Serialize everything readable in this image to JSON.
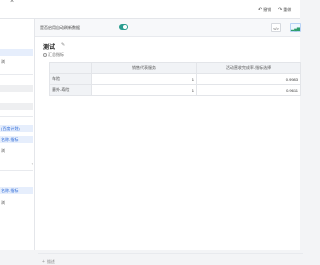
{
  "topbar": {
    "close_icon": "×",
    "btn1_label": "撤销",
    "btn2_label": "重做",
    "btn1_icon": "undo-icon",
    "btn2_icon": "redo-icon"
  },
  "left_panel": {
    "rows": [
      {
        "label": "",
        "style": ""
      },
      {
        "label": "",
        "style": "sel"
      },
      {
        "label": "浏",
        "style": ""
      },
      {
        "label": "",
        "style": "gray"
      },
      {
        "label": "",
        "style": "gray"
      },
      {
        "label": "",
        "style": ""
      },
      {
        "label": "(百度计划)",
        "style": "sel"
      },
      {
        "label": "名称-指标",
        "style": "sel"
      },
      {
        "label": "浏",
        "style": ""
      },
      {
        "label": "",
        "style": ""
      },
      {
        "label": "名称-指标",
        "style": "sel"
      },
      {
        "label": "浏",
        "style": ""
      }
    ]
  },
  "toolbar": {
    "toggle_label": "是否启用自动刷新数据",
    "toggle_on": true,
    "code_label": "</>",
    "chart_label": "📈"
  },
  "card": {
    "title": "测试",
    "edit_icon": "✎",
    "subtitle": "汇总指标"
  },
  "table": {
    "headers": [
      "",
      "销售代表服务",
      "活动营收完成率-指标选择"
    ],
    "rows": [
      {
        "dim": "车险",
        "c1": "1",
        "c2": "0.9983"
      },
      {
        "dim": "意外-寿险",
        "c1": "1",
        "c2": "0.9611"
      }
    ]
  },
  "footer": {
    "plus": "+",
    "label": "描述"
  },
  "colors": {
    "accent": "#2a9d8f",
    "selection": "#e6eefc",
    "header_bg": "#f1f3f6"
  }
}
